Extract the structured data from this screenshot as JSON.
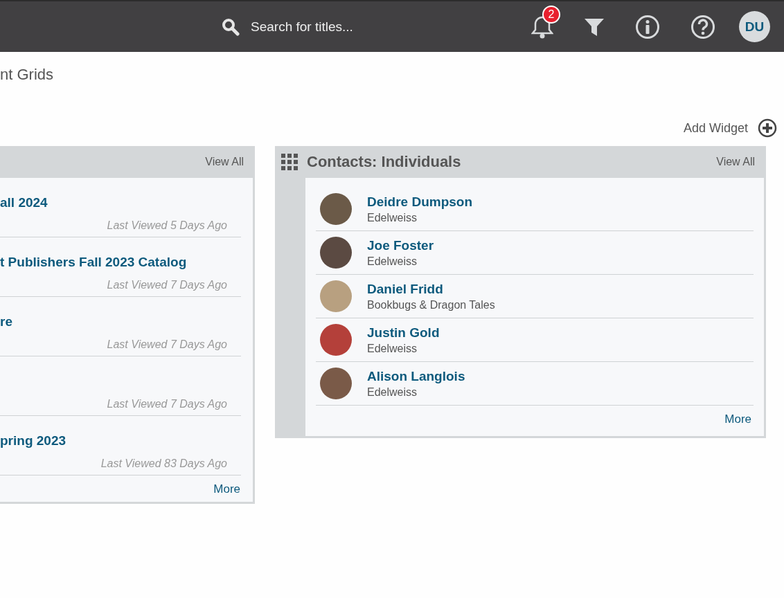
{
  "top_bar": {
    "search": {
      "placeholder": "Search for titles..."
    },
    "notifications": {
      "count": "2"
    },
    "avatar": {
      "initials": "DU"
    }
  },
  "page_title": "nt Grids",
  "add_widget": {
    "label": "Add Widget"
  },
  "widgets": [
    {
      "kind": "catalogs",
      "view_all": "View All",
      "items": [
        {
          "title": "all 2024",
          "viewed": "Last Viewed 5 Days Ago"
        },
        {
          "title": "t Publishers Fall 2023 Catalog",
          "viewed": "Last Viewed 7 Days Ago"
        },
        {
          "title": "re",
          "viewed": "Last Viewed 7 Days Ago"
        },
        {
          "viewed": "Last Viewed 7 Days Ago"
        },
        {
          "title": "pring 2023",
          "viewed": "Last Viewed 83 Days Ago"
        }
      ],
      "more": "More"
    },
    {
      "kind": "contacts",
      "title": "Contacts: Individuals",
      "view_all": "View All",
      "items": [
        {
          "name": "Deidre Dumpson",
          "org": "Edelweiss"
        },
        {
          "name": "Joe Foster",
          "org": "Edelweiss"
        },
        {
          "name": "Daniel Fridd",
          "org": "Bookbugs & Dragon Tales"
        },
        {
          "name": "Justin Gold",
          "org": "Edelweiss"
        },
        {
          "name": "Alison Langlois",
          "org": "Edelweiss"
        }
      ],
      "more": "More"
    }
  ]
}
